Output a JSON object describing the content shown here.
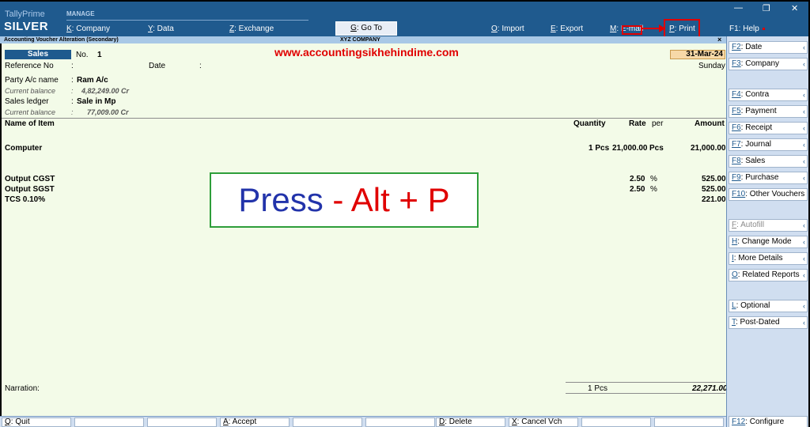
{
  "app": {
    "brand_top": "TallyPrime",
    "brand_bottom": "SILVER",
    "manage_label": "MANAGE"
  },
  "toolbar": {
    "company": {
      "key": "K",
      "label": ": Company"
    },
    "data": {
      "key": "Y",
      "label": ": Data"
    },
    "exchange": {
      "key": "Z",
      "label": ": Exchange"
    },
    "goto": {
      "key": "G",
      "label": ": Go To"
    },
    "import": {
      "key": "O",
      "label": ": Import"
    },
    "export": {
      "key": "E",
      "label": ": Export"
    },
    "email": {
      "key": "M",
      "label": ": E-mail"
    },
    "print": {
      "key": "P",
      "label": ": Print"
    },
    "help": {
      "key": "F1",
      "label": ": Help"
    }
  },
  "window_controls": {
    "minimize": "—",
    "restore": "❐",
    "close": "✕"
  },
  "subbar": {
    "title": "Accounting Voucher Alteration (Secondary)",
    "company": "XYZ COMPANY",
    "close": "×"
  },
  "voucher": {
    "type": "Sales",
    "no_label": "No.",
    "no_value": "1",
    "date_value": "31-Mar-24",
    "day": "Sunday",
    "reference_label": "Reference No",
    "reference_colon": ":",
    "date_label": "Date",
    "date_colon": ":",
    "party_label": "Party A/c name",
    "party_colon": ":",
    "party_value": "Ram A/c",
    "party_balance_label": "Current balance",
    "party_balance_colon": ":",
    "party_balance_value": "4,82,249.00 Cr",
    "ledger_label": "Sales ledger",
    "ledger_colon": ":",
    "ledger_value": "Sale in Mp",
    "ledger_balance_label": "Current balance",
    "ledger_balance_colon": ":",
    "ledger_balance_value": "77,009.00 Cr"
  },
  "watermark_url": "www.accountingsikhehindime.com",
  "table": {
    "headers": {
      "item": "Name of Item",
      "quantity": "Quantity",
      "rate": "Rate",
      "per": "per",
      "amount": "Amount"
    },
    "item": {
      "name": "Computer",
      "quantity": "1 Pcs",
      "rate": "21,000.00",
      "per": "Pcs",
      "amount": "21,000.00"
    },
    "taxes": [
      {
        "name": "Output CGST",
        "rate": "2.50",
        "per": "%",
        "amount": "525.00"
      },
      {
        "name": "Output SGST",
        "rate": "2.50",
        "per": "%",
        "amount": "525.00"
      },
      {
        "name": "TCS 0.10%",
        "rate": "",
        "per": "",
        "amount": "221.00"
      }
    ],
    "total_quantity": "1 Pcs",
    "total_amount": "22,271.00"
  },
  "narration_label": "Narration:",
  "annotation": {
    "press": "Press",
    "dash": "-",
    "keys": "Alt + P"
  },
  "right_panel": [
    {
      "key": "F2",
      "label": ": Date",
      "chev": "‹"
    },
    {
      "key": "F3",
      "label": ": Company",
      "chev": "‹"
    },
    {
      "key": "F4",
      "label": ": Contra",
      "chev": "‹"
    },
    {
      "key": "F5",
      "label": ": Payment",
      "chev": "‹"
    },
    {
      "key": "F6",
      "label": ": Receipt",
      "chev": "‹"
    },
    {
      "key": "F7",
      "label": ": Journal",
      "chev": "‹"
    },
    {
      "key": "F8",
      "label": ": Sales",
      "chev": "‹"
    },
    {
      "key": "F9",
      "label": ": Purchase",
      "chev": "‹"
    },
    {
      "key": "F10",
      "label": ": Other Vouchers",
      "chev": ""
    },
    {
      "key": "F",
      "label": ": Autofill",
      "chev": "‹"
    },
    {
      "key": "H",
      "label": ": Change Mode",
      "chev": "‹"
    },
    {
      "key": "I",
      "label": ": More Details",
      "chev": "‹"
    },
    {
      "key": "O",
      "label": ": Related Reports",
      "chev": "‹"
    },
    {
      "key": "L",
      "label": ": Optional",
      "chev": "‹"
    },
    {
      "key": "T",
      "label": ": Post-Dated",
      "chev": "‹"
    },
    {
      "key": "F12",
      "label": ": Configure",
      "chev": ""
    }
  ],
  "bottom_bar": {
    "quit": {
      "key": "Q",
      "label": ": Quit"
    },
    "accept": {
      "key": "A",
      "label": ": Accept"
    },
    "delete": {
      "key": "D",
      "label": ": Delete"
    },
    "cancel": {
      "key": "X",
      "label": ": Cancel Vch"
    }
  }
}
